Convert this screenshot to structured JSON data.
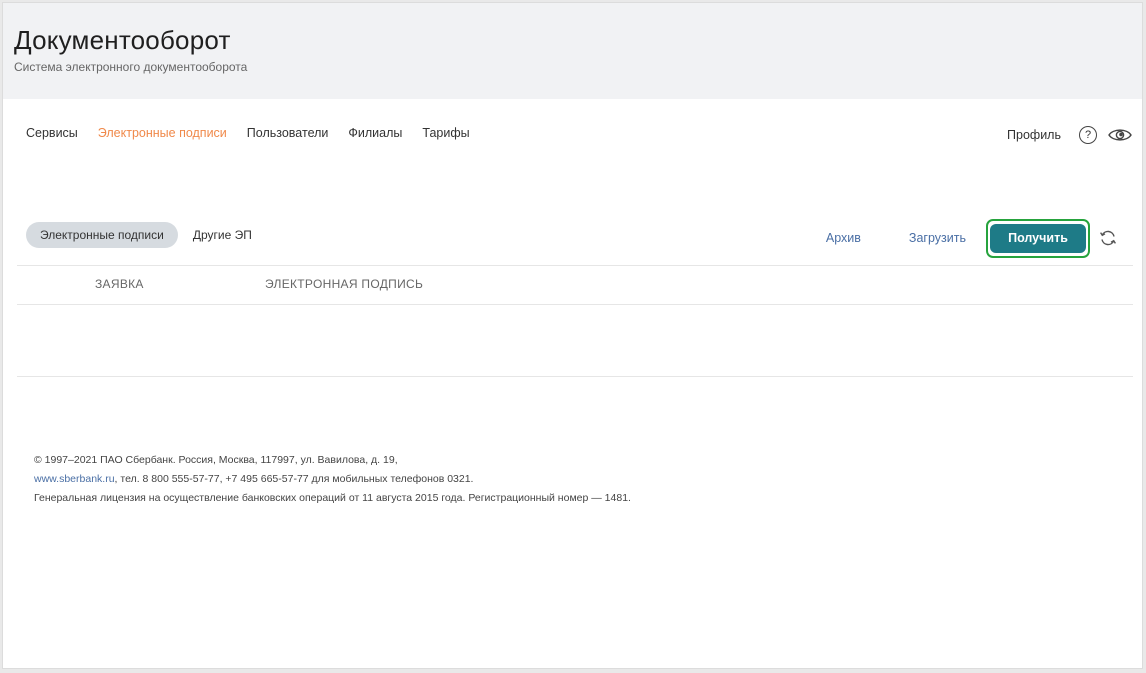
{
  "app": {
    "title": "Документооборот",
    "subtitle": "Система электронного документооборота"
  },
  "nav": {
    "items": [
      {
        "label": "Сервисы",
        "active": false
      },
      {
        "label": "Электронные подписи",
        "active": true
      },
      {
        "label": "Пользователи",
        "active": false
      },
      {
        "label": "Филиалы",
        "active": false
      },
      {
        "label": "Тарифы",
        "active": false
      }
    ],
    "profile_label": "Профиль",
    "help_glyph": "?",
    "help_icon": "question-circle-icon",
    "eye_icon": "eye-icon"
  },
  "tabs": {
    "active_label": "Электронные подписи",
    "other_label": "Другие ЭП"
  },
  "actions": {
    "archive_label": "Архив",
    "upload_label": "Загрузить",
    "get_label": "Получить",
    "refresh_icon": "refresh-icon"
  },
  "table": {
    "columns": [
      "ЗАЯВКА",
      "ЭЛЕКТРОННАЯ ПОДПИСЬ"
    ],
    "rows": []
  },
  "footer": {
    "line1": "© 1997–2021 ПАО Сбербанк. Россия, Москва, 117997, ул. Вавилова, д. 19,",
    "link": "www.sberbank.ru",
    "line2_rest": ", тел. 8 800 555-57-77, +7 495 665-57-77 для мобильных телефонов 0321.",
    "line3": "Генеральная лицензия на осуществление банковских операций от 11 августа 2015 года. Регистрационный номер — 1481."
  },
  "colors": {
    "accent_orange": "#f0894a",
    "primary_teal": "#1e7b87",
    "highlight_green": "#26a33d",
    "link_blue": "#4a6fa5",
    "header_bg": "#f1f2f4"
  }
}
